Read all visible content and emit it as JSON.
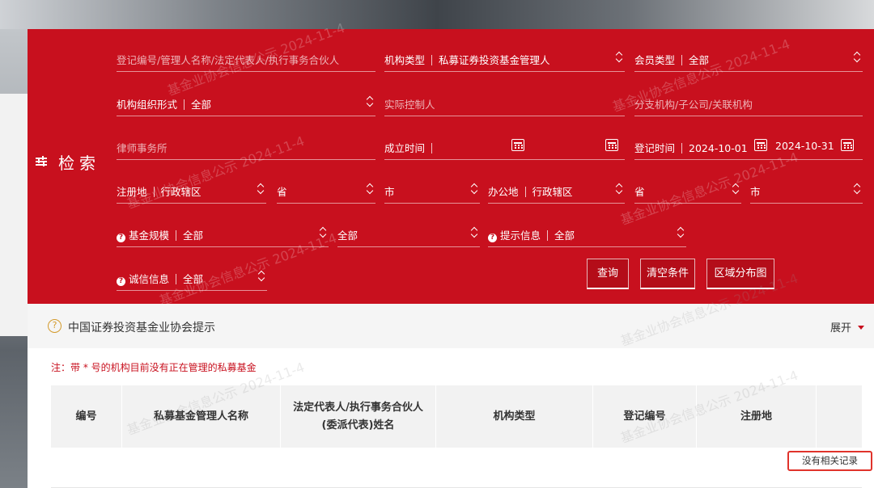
{
  "search": {
    "title": "检索",
    "reg_no_placeholder": "登记编号/管理人名称/法定代表人/执行事务合伙人",
    "org_type_label": "机构类型",
    "org_type_value": "私募证券投资基金管理人",
    "member_type_label": "会员类型",
    "member_type_value": "全部",
    "org_form_label": "机构组织形式",
    "org_form_value": "全部",
    "controller_placeholder": "实际控制人",
    "branch_placeholder": "分支机构/子公司/关联机构",
    "law_firm_placeholder": "律师事务所",
    "established_label": "成立时间",
    "reg_time_label": "登记时间",
    "reg_time_start": "2024-10-01",
    "reg_time_end": "2024-10-31",
    "reg_place_label": "注册地",
    "reg_place_value": "行政辖区",
    "province_1": "省",
    "city_1": "市",
    "office_label": "办公地",
    "office_value": "行政辖区",
    "province_2": "省",
    "city_2": "市",
    "fund_scale_label": "基金规模",
    "fund_scale_value": "全部",
    "fund_scale_value_2": "全部",
    "hint_label": "提示信息",
    "hint_value": "全部",
    "credit_label": "诚信信息",
    "credit_value": "全部",
    "query_button": "查询",
    "clear_button": "清空条件",
    "map_button": "区域分布图"
  },
  "tip": {
    "icon": "?",
    "text": "中国证券投资基金业协会提示",
    "expand_label": "展开"
  },
  "note": "注：带 * 号的机构目前没有正在管理的私募基金",
  "table": {
    "columns": [
      "编号",
      "私募基金管理人名称",
      "法定代表人/执行事务合伙人\n(委派代表)姓名",
      "机构类型",
      "登记编号",
      "注册地",
      ""
    ],
    "empty_text": "没有相关记录"
  },
  "watermark": "基金业协会信息公示 2024-11-4",
  "colors": {
    "panel_red": "#c8101e",
    "highlight_red": "#e0332b",
    "tip_icon": "#d39a2b"
  }
}
